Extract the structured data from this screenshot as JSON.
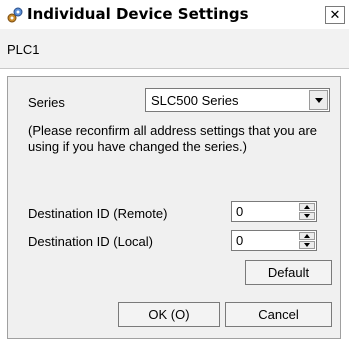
{
  "window": {
    "title": "Individual Device Settings",
    "close_glyph": "✕",
    "icon": "gear-settings-icon"
  },
  "device": {
    "name": "PLC1"
  },
  "series": {
    "label": "Series",
    "value": "SLC500 Series"
  },
  "note": {
    "text": "(Please reconfirm all address settings that you are using if you have changed the series.)"
  },
  "destination_remote": {
    "label": "Destination ID (Remote)",
    "value": "0"
  },
  "destination_local": {
    "label": "Destination ID (Local)",
    "value": "0"
  },
  "buttons": {
    "default": "Default",
    "ok": "OK (O)",
    "cancel": "Cancel"
  }
}
